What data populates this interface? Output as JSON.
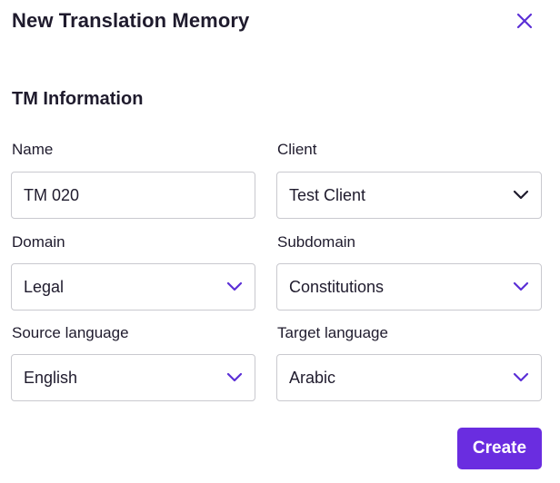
{
  "dialog": {
    "title": "New Translation Memory",
    "close_icon": "close-icon",
    "accent_color": "#6a2de0"
  },
  "section": {
    "title": "TM Information"
  },
  "fields": {
    "name": {
      "label": "Name",
      "value": "TM 020"
    },
    "client": {
      "label": "Client",
      "value": "Test Client",
      "icon": "chevron-down-icon"
    },
    "domain": {
      "label": "Domain",
      "value": "Legal",
      "icon": "chevron-down-icon"
    },
    "subdomain": {
      "label": "Subdomain",
      "value": "Constitutions",
      "icon": "chevron-down-icon"
    },
    "source_language": {
      "label": "Source language",
      "value": "English",
      "icon": "chevron-down-icon"
    },
    "target_language": {
      "label": "Target language",
      "value": "Arabic",
      "icon": "chevron-down-icon"
    }
  },
  "actions": {
    "create_label": "Create"
  }
}
